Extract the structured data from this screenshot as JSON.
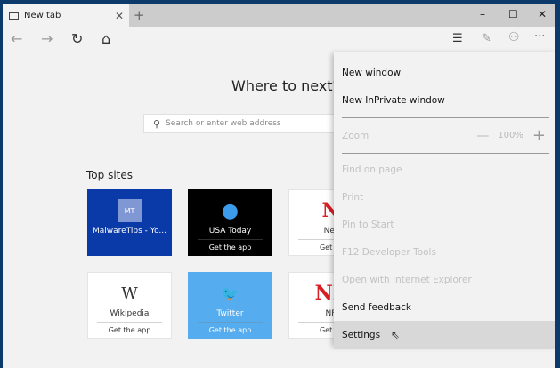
{
  "tab": {
    "title": "New tab",
    "icon": "tab-page-icon"
  },
  "window_controls": {
    "minimize": "–",
    "maximize": "☐",
    "close": "✕"
  },
  "toolbar": {
    "back": "←",
    "forward": "→",
    "refresh": "↻",
    "home": "⌂",
    "hub": "☰",
    "note": "✎",
    "share": "⚇",
    "more": "···"
  },
  "page": {
    "title": "Where to next?",
    "search_placeholder": "Search or enter web address",
    "top_sites_label": "Top sites"
  },
  "tiles": [
    {
      "name": "MalwareTips - Yo...",
      "sub": "",
      "logo": "MT",
      "bg": "#0a3aa8",
      "fg": "#ffffff"
    },
    {
      "name": "USA Today",
      "sub": "Get the app",
      "logo": "●",
      "bg": "#000000",
      "fg": "#ffffff"
    },
    {
      "name": "Net",
      "sub": "Get th",
      "logo": "N",
      "bg": "#ffffff",
      "fg": "#333333"
    },
    {
      "name": "Wikipedia",
      "sub": "Get the app",
      "logo": "W",
      "bg": "#ffffff",
      "fg": "#333333"
    },
    {
      "name": "Twitter",
      "sub": "Get the app",
      "logo": "🐦",
      "bg": "#55acee",
      "fg": "#ffffff"
    },
    {
      "name": "NF",
      "sub": "Get th",
      "logo": "NF",
      "bg": "#ffffff",
      "fg": "#333333"
    }
  ],
  "menu": {
    "new_window": "New window",
    "new_inprivate": "New InPrivate window",
    "zoom": "Zoom",
    "zoom_minus": "—",
    "zoom_value": "100%",
    "zoom_plus": "+",
    "find": "Find on page",
    "print": "Print",
    "pin": "Pin to Start",
    "devtools": "F12 Developer Tools",
    "open_ie": "Open with Internet Explorer",
    "feedback": "Send feedback",
    "settings": "Settings"
  }
}
